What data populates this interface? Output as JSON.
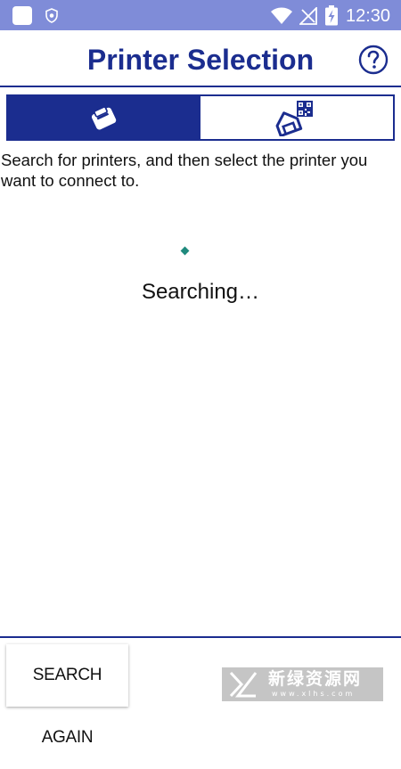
{
  "status_bar": {
    "time": "12:30",
    "icons": [
      "app-square-icon",
      "shield-icon",
      "wifi-icon",
      "signal-icon",
      "battery-charging-icon"
    ]
  },
  "header": {
    "title": "Printer Selection",
    "help_icon": "help-circle-icon"
  },
  "tabs": [
    {
      "icon": "printer-cube-icon",
      "selected": true
    },
    {
      "icon": "qr-house-icon",
      "selected": false
    }
  ],
  "instruction": "Search for printers, and then select the printer you want to connect to.",
  "searching": "Searching…",
  "footer": {
    "search_again_label": "SEARCH AGAIN"
  },
  "watermark": {
    "text": "新绿资源网",
    "sub": "www.xlhs.com"
  },
  "colors": {
    "status_bar": "#7f8cd8",
    "primary": "#1b2d8f",
    "spinner": "#1f8a7d",
    "background": "#ffffff"
  }
}
